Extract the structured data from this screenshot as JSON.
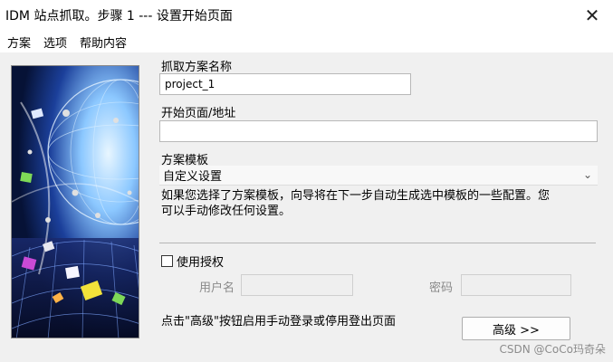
{
  "window": {
    "title": "IDM 站点抓取。步骤 1 --- 设置开始页面",
    "close_glyph": "✕"
  },
  "menu": {
    "items": [
      "方案",
      "选项",
      "帮助内容"
    ]
  },
  "form": {
    "project_name_label": "抓取方案名称",
    "project_name_value": "project_1",
    "start_page_label": "开始页面/地址",
    "start_page_value": "",
    "template_label": "方案模板",
    "template_selected": "自定义设置",
    "template_description_line1": "如果您选择了方案模板，向导将在下一步自动生成选中模板的一些配置。您",
    "template_description_line2": "可以手动修改任何设置。",
    "use_auth_label": "使用授权",
    "use_auth_checked": false,
    "username_label": "用户名",
    "username_value": "",
    "password_label": "密码",
    "password_value": "",
    "advanced_hint": "点击\"高级\"按钮启用手动登录或停用登出页面",
    "advanced_button_label": "高级 >>"
  },
  "watermark": "CSDN @CoCo玛奇朵",
  "colors": {
    "window_bg": "#f0f0f0",
    "titlebar_bg": "#ffffff",
    "art_base": "#0b1a55",
    "art_glow": "#9ad0ff"
  }
}
